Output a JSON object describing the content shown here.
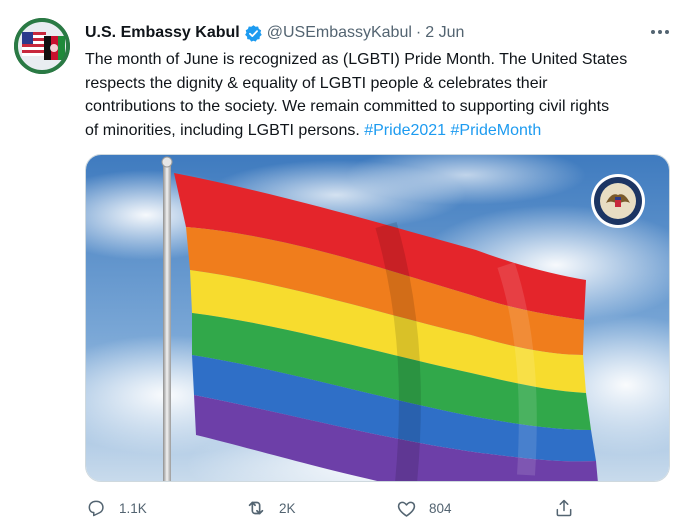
{
  "tweet": {
    "display_name": "U.S. Embassy Kabul",
    "handle": "@USEmbassyKabul",
    "separator": "·",
    "time": "2 Jun",
    "text_lines": [
      "The month of June is recognized as (LGBTI) Pride Month. The United States",
      "respects the dignity & equality of LGBTI people & celebrates their",
      "contributions to the society. We remain committed to supporting civil rights",
      "of minorities, including LGBTI persons. "
    ],
    "hashtags": [
      "#Pride2021",
      "#PrideMonth"
    ],
    "accent_color": "#1d9bf0"
  },
  "actions": {
    "reply_count": "1.1K",
    "retweet_count": "2K",
    "like_count": "804"
  },
  "icons": [
    "verified-badge-icon",
    "more-icon",
    "reply-icon",
    "retweet-icon",
    "like-icon",
    "share-icon"
  ]
}
